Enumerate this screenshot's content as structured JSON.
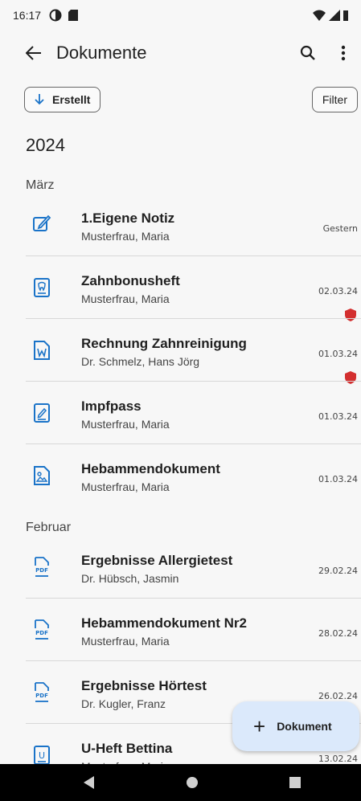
{
  "status": {
    "time": "16:17"
  },
  "appbar": {
    "title": "Dokumente"
  },
  "chips": {
    "sort_label": "Erstellt",
    "filter_label": "Filter"
  },
  "year": "2024",
  "months": [
    "März",
    "Februar"
  ],
  "documents": [
    {
      "title": "1.Eigene Notiz",
      "author": "Musterfrau, Maria",
      "date": "Gestern",
      "icon": "note-edit-icon",
      "shield": false
    },
    {
      "title": "Zahnbonusheft",
      "author": "Musterfrau, Maria",
      "date": "02.03.24",
      "icon": "tooth-document-icon",
      "shield": true
    },
    {
      "title": "Rechnung Zahnreinigung",
      "author": "Dr. Schmelz, Hans Jörg",
      "date": "01.03.24",
      "icon": "word-document-icon",
      "shield": true
    },
    {
      "title": "Impfpass",
      "author": "Musterfrau, Maria",
      "date": "01.03.24",
      "icon": "pen-document-icon",
      "shield": false
    },
    {
      "title": "Hebammendokument",
      "author": "Musterfrau, Maria",
      "date": "01.03.24",
      "icon": "image-document-icon",
      "shield": false
    },
    {
      "title": "Ergebnisse Allergietest",
      "author": "Dr. Hübsch, Jasmin",
      "date": "29.02.24",
      "icon": "pdf-document-icon",
      "shield": false
    },
    {
      "title": "Hebammendokument Nr2",
      "author": "Musterfrau, Maria",
      "date": "28.02.24",
      "icon": "pdf-document-icon",
      "shield": false
    },
    {
      "title": "Ergebnisse Hörtest",
      "author": "Dr. Kugler, Franz",
      "date": "26.02.24",
      "icon": "pdf-document-icon",
      "shield": false
    },
    {
      "title": "U-Heft Bettina",
      "author": "Musterfrau, Maria",
      "date": "13.02.24",
      "icon": "u-document-icon",
      "shield": false
    }
  ],
  "fab": {
    "label": "Dokument"
  },
  "colors": {
    "accent": "#1a73c8",
    "shield": "#d32f2f",
    "fab_bg": "#dbe9fb"
  }
}
